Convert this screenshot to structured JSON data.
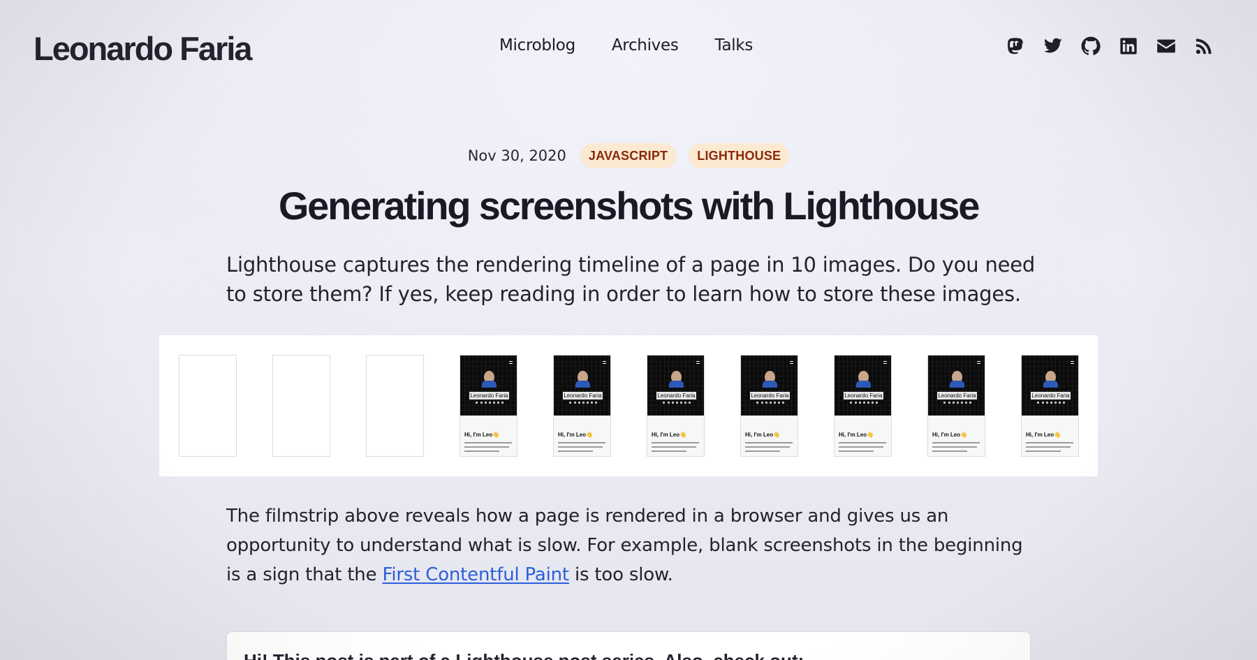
{
  "header": {
    "logo": "Leonardo Faria",
    "nav": [
      {
        "label": "Microblog"
      },
      {
        "label": "Archives"
      },
      {
        "label": "Talks"
      }
    ],
    "social": [
      {
        "name": "mastodon-icon"
      },
      {
        "name": "twitter-icon"
      },
      {
        "name": "github-icon"
      },
      {
        "name": "linkedin-icon"
      },
      {
        "name": "email-icon"
      },
      {
        "name": "rss-icon"
      }
    ]
  },
  "post": {
    "date": "Nov 30, 2020",
    "tags": [
      "JAVASCRIPT",
      "LIGHTHOUSE"
    ],
    "title": "Generating screenshots with Lighthouse",
    "lead": "Lighthouse captures the rendering timeline of a page in 10 images. Do you need to store them? If yes, keep reading in order to learn how to store these images.",
    "filmstrip": {
      "frame_count": 10,
      "blank_frames": 3,
      "frame_name_label": "Leonardo Faria",
      "frame_greeting": "Hi, I'm Leo👋"
    },
    "body_before_link": "The filmstrip above reveals how a page is rendered in a browser and gives us an opportunity to understand what is slow. For example, blank screenshots in the beginning is a sign that the ",
    "body_link": "First Contentful Paint",
    "body_after_link": " is too slow.",
    "callout": "Hi! This post is part of a Lighthouse post series. Also, check out:"
  },
  "colors": {
    "tag_text": "#8a2a0a",
    "tag_bg": "#fbe9d2",
    "link": "#2b5fd9"
  }
}
